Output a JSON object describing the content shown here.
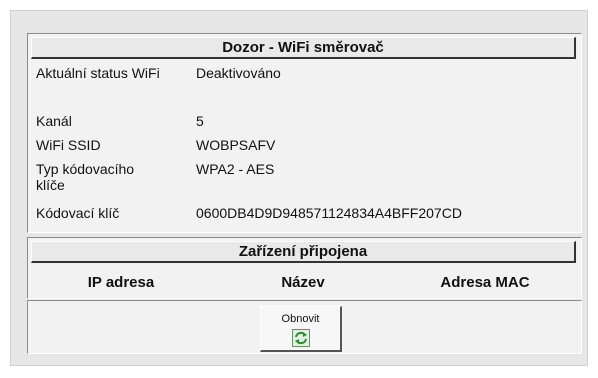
{
  "monitor": {
    "title": "Dozor - WiFi směrovač",
    "rows": [
      {
        "label": "Aktuální status WiFi",
        "value": "Deaktivováno"
      },
      {
        "label": "Kanál",
        "value": "5"
      },
      {
        "label": "WiFi SSID",
        "value": "WOBPSAFV"
      },
      {
        "label": "Typ kódovacího klíče",
        "value": "WPA2 - AES"
      },
      {
        "label": "Kódovací klíč",
        "value": "0600DB4D9D948571124834A4BFF207CD"
      }
    ]
  },
  "devices": {
    "title": "Zařízení připojena",
    "columns": [
      "IP adresa",
      "Název",
      "Adresa MAC"
    ],
    "rows": []
  },
  "actions": {
    "refresh_label": "Obnovit",
    "refresh_icon": "refresh-icon"
  },
  "colors": {
    "panel_bg": "#e6e6e6",
    "section_bg": "#f2f2f2",
    "icon_green": "#2e8b2e"
  }
}
